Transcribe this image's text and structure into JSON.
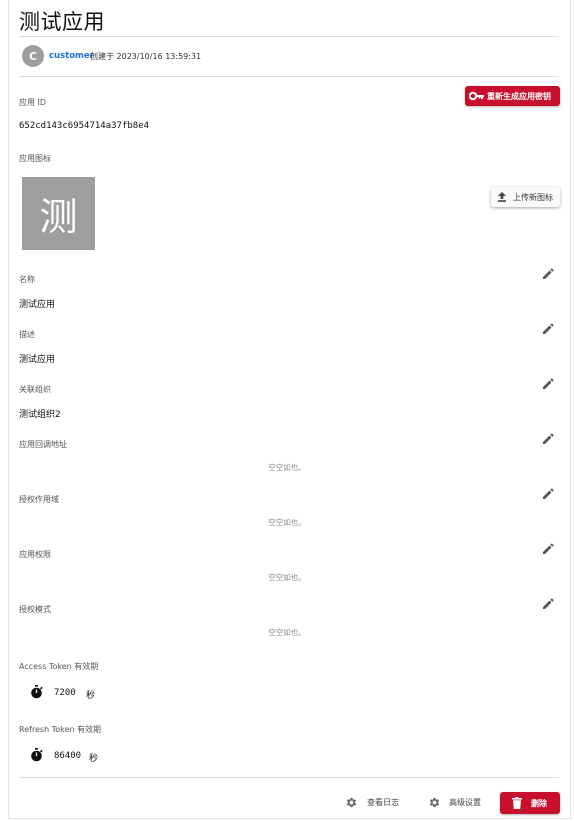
{
  "header": {
    "title": "测试应用",
    "avatar_letter": "C",
    "owner": "customer",
    "created_text": "创建于 2023/10/16 13:59:31"
  },
  "app_id": {
    "label": "应用 ID",
    "value": "652cd143c6954714a37fb8e4",
    "regenerate_label": "重新生成应用密钥"
  },
  "app_icon": {
    "label": "应用图标",
    "char": "测",
    "upload_label": "上传新图标"
  },
  "fields": {
    "name": {
      "label": "名称",
      "value": "测试应用"
    },
    "description": {
      "label": "描述",
      "value": "测试应用"
    },
    "org": {
      "label": "关联组织",
      "value": "测试组织2"
    },
    "callback": {
      "label": "应用回调地址",
      "empty": "空空如也。"
    },
    "scope": {
      "label": "授权作用域",
      "empty": "空空如也。"
    },
    "permissions": {
      "label": "应用权限",
      "empty": "空空如也。"
    },
    "grant_mode": {
      "label": "授权模式",
      "empty": "空空如也。"
    }
  },
  "access_token": {
    "label": "Access Token 有效期",
    "value": "7200",
    "unit": "秒"
  },
  "refresh_token": {
    "label": "Refresh Token 有效期",
    "value": "86400",
    "unit": "秒"
  },
  "footer": {
    "logs_label": "查看日志",
    "advanced_label": "高级设置",
    "delete_label": "删除"
  },
  "colors": {
    "accent": "#c8102e",
    "link": "#1e6fd6",
    "avatar": "#9e9e9e"
  }
}
